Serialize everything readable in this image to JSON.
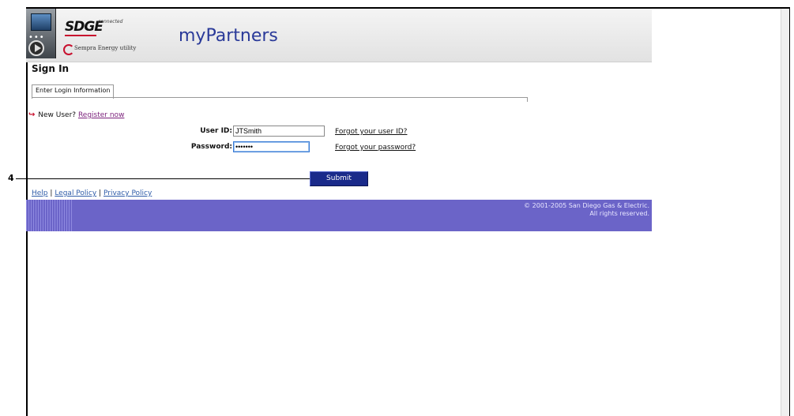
{
  "header": {
    "brand_top": "SDGE",
    "brand_connected": "connected",
    "brand_sub": "Sempra Energy utility",
    "site_title": "myPartners"
  },
  "page": {
    "heading": "Sign In",
    "tab_label": "Enter Login Information"
  },
  "new_user": {
    "prefix": "New User?",
    "link": "Register now"
  },
  "form": {
    "user_id_label": "User ID:",
    "user_id_value": "JTSmith",
    "forgot_user_id": "Forgot your user ID?",
    "password_label": "Password:",
    "password_value": "•••••••",
    "forgot_password": "Forgot your password?",
    "submit_label": "Submit"
  },
  "callout": {
    "step_number": "4"
  },
  "footer": {
    "links": [
      "Help",
      "Legal Policy",
      "Privacy Policy"
    ],
    "separator": "|",
    "copyright_line1": "© 2001-2005 San Diego Gas & Electric.",
    "copyright_line2": "All rights reserved.",
    "bar_color": "#6b64c8"
  },
  "icons": {
    "launcher": "video-player-icon",
    "play": "play-icon",
    "new_user_arrow": "arrow-icon"
  }
}
